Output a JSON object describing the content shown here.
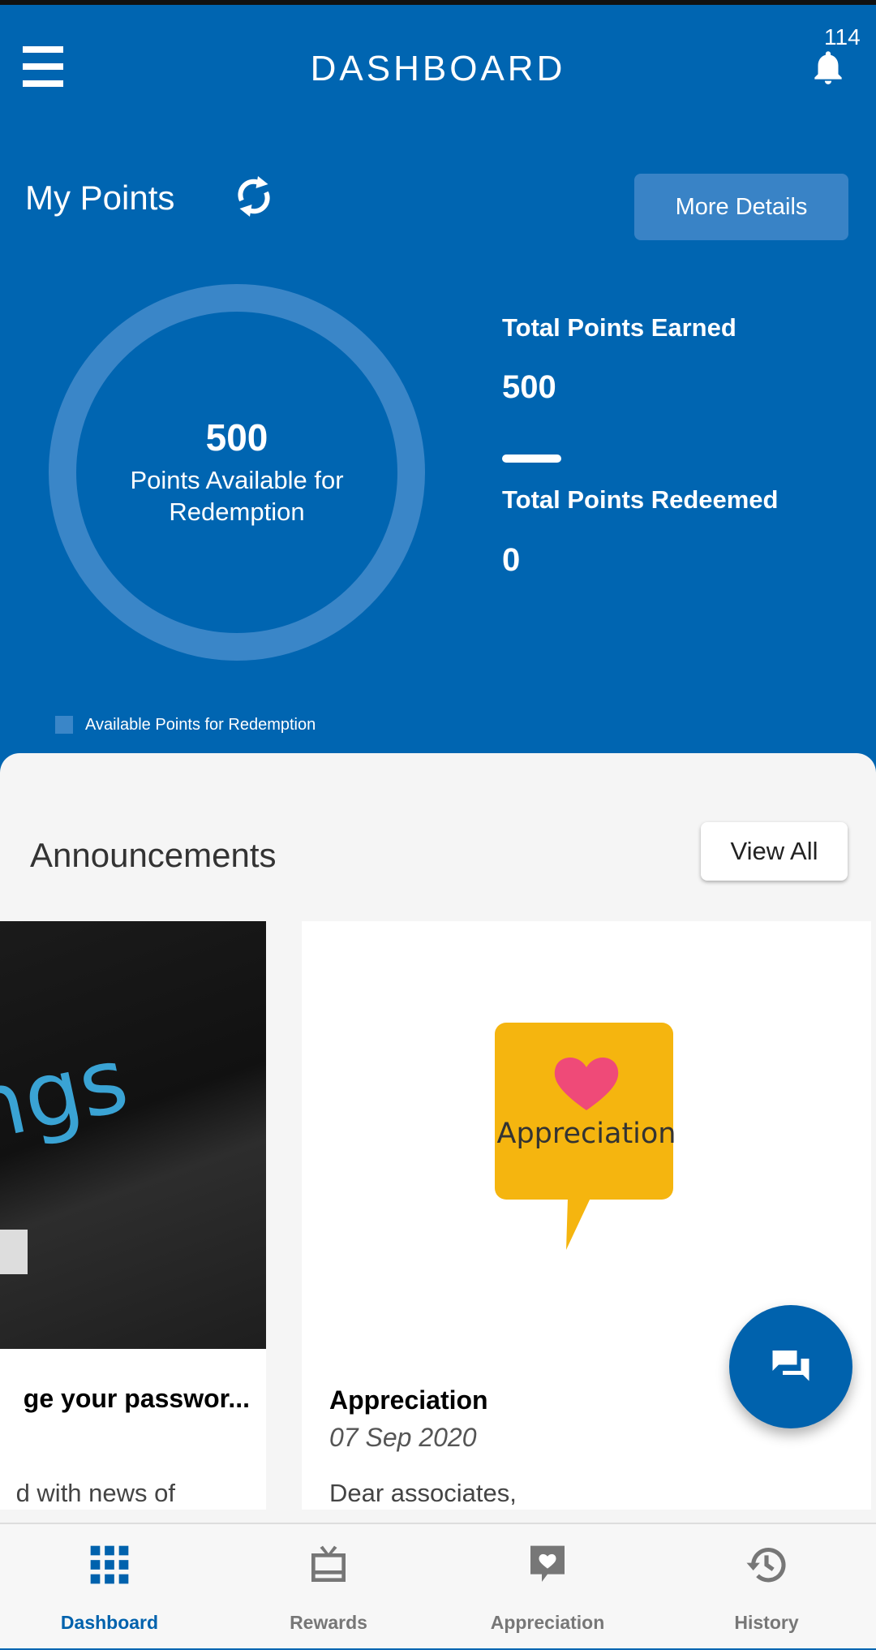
{
  "header": {
    "title": "DASHBOARD",
    "notification_count": "114"
  },
  "points": {
    "title": "My Points",
    "more_details": "More Details",
    "available": "500",
    "available_label": "Points Available for Redemption",
    "available_fraction": 1.0,
    "total_earned_label": "Total Points Earned",
    "total_earned": "500",
    "total_redeemed_label": "Total Points Redeemed",
    "total_redeemed": "0",
    "legend": "Available Points for Redemption"
  },
  "announcements": {
    "title": "Announcements",
    "view_all": "View All",
    "cards": [
      {
        "title": "ge your passwor...",
        "body": "d with news of"
      },
      {
        "title": "Appreciation",
        "date": "07 Sep 2020",
        "body": "Dear associates,",
        "image_text": "Appreciation"
      }
    ]
  },
  "nav": [
    {
      "label": "Dashboard",
      "icon": "grid-icon",
      "active": true
    },
    {
      "label": "Rewards",
      "icon": "gift-card-icon"
    },
    {
      "label": "Appreciation",
      "icon": "heart-chat-icon"
    },
    {
      "label": "History",
      "icon": "history-icon"
    }
  ],
  "colors": {
    "primary": "#0065b1",
    "ring": "#3a86c8",
    "appreciation_yellow": "#f5b50f",
    "heart": "#ef4a78"
  }
}
